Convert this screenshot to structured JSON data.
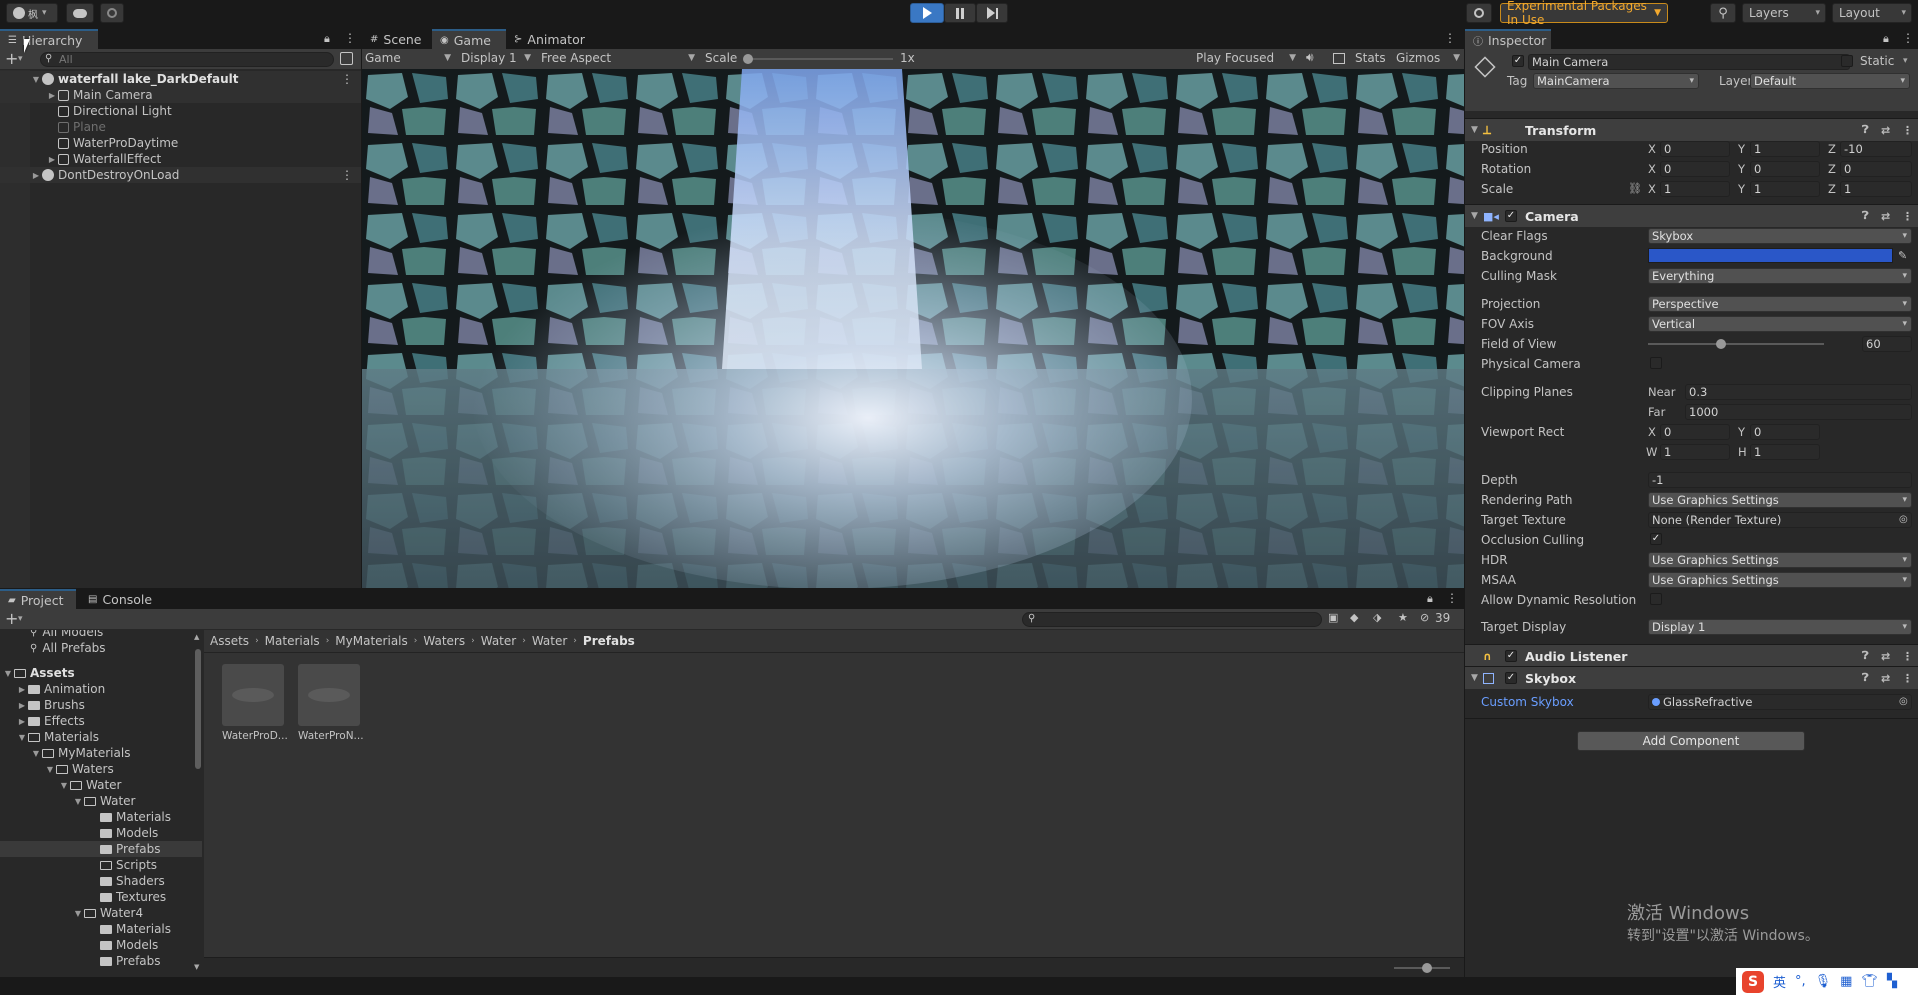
{
  "toolbar": {
    "account_label": "枫",
    "experimental_label": "Experimental Packages In Use",
    "layers_label": "Layers",
    "layout_label": "Layout"
  },
  "hierarchy": {
    "tab_label": "Hierarchy",
    "search_placeholder": "All",
    "items": [
      {
        "label": "waterfall lake_DarkDefault"
      },
      {
        "label": "Main Camera"
      },
      {
        "label": "Directional Light"
      },
      {
        "label": "Plane"
      },
      {
        "label": "WaterProDaytime"
      },
      {
        "label": "WaterfallEffect"
      },
      {
        "label": "DontDestroyOnLoad"
      }
    ]
  },
  "view_tabs": {
    "scene": "Scene",
    "game": "Game",
    "animator": "Animator"
  },
  "game_bar": {
    "mode": "Game",
    "display": "Display 1",
    "aspect": "Free Aspect",
    "scale_label": "Scale",
    "scale_value": "1x",
    "play_focused": "Play Focused",
    "stats": "Stats",
    "gizmos": "Gizmos"
  },
  "inspector": {
    "tab_label": "Inspector",
    "object_name": "Main Camera",
    "static_label": "Static",
    "tag_label": "Tag",
    "tag_value": "MainCamera",
    "layer_label": "Layer",
    "layer_value": "Default",
    "transform": {
      "title": "Transform",
      "position_label": "Position",
      "pos_x": "0",
      "pos_y": "1",
      "pos_z": "-10",
      "rotation_label": "Rotation",
      "rot_x": "0",
      "rot_y": "0",
      "rot_z": "0",
      "scale_label": "Scale",
      "scale_x": "1",
      "scale_y": "1",
      "scale_z": "1"
    },
    "camera": {
      "title": "Camera",
      "clear_flags_label": "Clear Flags",
      "clear_flags": "Skybox",
      "background_label": "Background",
      "background_color": "#2a57c8",
      "culling_mask_label": "Culling Mask",
      "culling_mask": "Everything",
      "projection_label": "Projection",
      "projection": "Perspective",
      "fov_axis_label": "FOV Axis",
      "fov_axis": "Vertical",
      "fov_label": "Field of View",
      "fov_value": "60",
      "physical_label": "Physical Camera",
      "clipping_label": "Clipping Planes",
      "near_label": "Near",
      "near": "0.3",
      "far_label": "Far",
      "far": "1000",
      "viewport_label": "Viewport Rect",
      "vp_x": "0",
      "vp_y": "0",
      "vp_w": "1",
      "vp_h": "1",
      "depth_label": "Depth",
      "depth": "-1",
      "rendering_path_label": "Rendering Path",
      "rendering_path": "Use Graphics Settings",
      "target_texture_label": "Target Texture",
      "target_texture": "None (Render Texture)",
      "occlusion_label": "Occlusion Culling",
      "hdr_label": "HDR",
      "hdr": "Use Graphics Settings",
      "msaa_label": "MSAA",
      "msaa": "Use Graphics Settings",
      "dynamic_label": "Allow Dynamic Resolution",
      "target_display_label": "Target Display",
      "target_display": "Display 1"
    },
    "audio_listener": {
      "title": "Audio Listener"
    },
    "skybox": {
      "title": "Skybox",
      "custom_label": "Custom Skybox",
      "custom_value": "GlassRefractive"
    },
    "add_component": "Add Component"
  },
  "project": {
    "tab_project": "Project",
    "tab_console": "Console",
    "hidden_count": "39",
    "breadcrumb": [
      "Assets",
      "Materials",
      "MyMaterials",
      "Waters",
      "Water",
      "Water",
      "Prefabs"
    ],
    "favorites": [
      "All Models",
      "All Prefabs"
    ],
    "tree": [
      {
        "label": "Assets"
      },
      {
        "label": "Animation"
      },
      {
        "label": "Brushs"
      },
      {
        "label": "Effects"
      },
      {
        "label": "Materials"
      },
      {
        "label": "MyMaterials"
      },
      {
        "label": "Waters"
      },
      {
        "label": "Water"
      },
      {
        "label": "Water"
      },
      {
        "label": "Materials"
      },
      {
        "label": "Models"
      },
      {
        "label": "Prefabs"
      },
      {
        "label": "Scripts"
      },
      {
        "label": "Shaders"
      },
      {
        "label": "Textures"
      },
      {
        "label": "Water4"
      },
      {
        "label": "Materials"
      },
      {
        "label": "Models"
      },
      {
        "label": "Prefabs"
      }
    ],
    "assets": [
      {
        "label": "WaterProD..."
      },
      {
        "label": "WaterProN..."
      }
    ]
  },
  "watermark": {
    "line1": "激活 Windows",
    "line2": "转到\"设置\"以激活 Windows。"
  },
  "ime": {
    "lang": "英"
  }
}
